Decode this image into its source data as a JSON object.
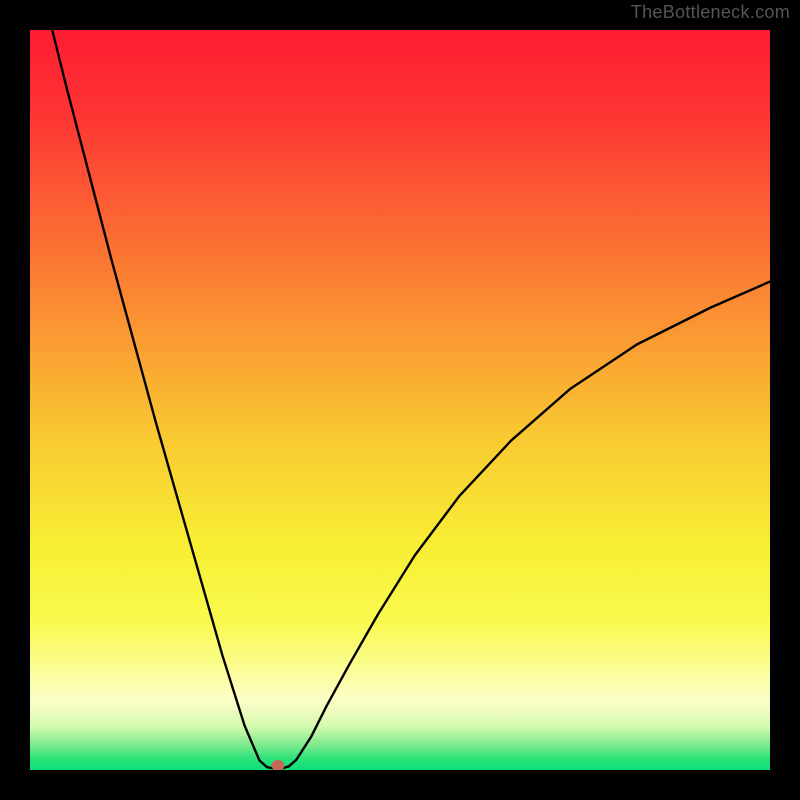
{
  "watermark": "TheBottleneck.com",
  "chart_data": {
    "type": "line",
    "title": "",
    "xlabel": "",
    "ylabel": "",
    "xlim": [
      0,
      100
    ],
    "ylim": [
      0,
      100
    ],
    "grid": false,
    "legend": false,
    "background_gradient": [
      {
        "offset": 0.0,
        "color": "#fe1c32"
      },
      {
        "offset": 0.12,
        "color": "#fd3633"
      },
      {
        "offset": 0.25,
        "color": "#fb6333"
      },
      {
        "offset": 0.4,
        "color": "#fa9533"
      },
      {
        "offset": 0.55,
        "color": "#f9c932"
      },
      {
        "offset": 0.7,
        "color": "#f8ef34"
      },
      {
        "offset": 0.8,
        "color": "#f9fa4f"
      },
      {
        "offset": 0.86,
        "color": "#fbfc90"
      },
      {
        "offset": 0.905,
        "color": "#fdfec8"
      },
      {
        "offset": 0.94,
        "color": "#d7fab1"
      },
      {
        "offset": 0.965,
        "color": "#82eb8e"
      },
      {
        "offset": 0.985,
        "color": "#2de27a"
      },
      {
        "offset": 1.0,
        "color": "#0bdf79"
      }
    ],
    "series": [
      {
        "name": "bottleneck_curve",
        "x": [
          3,
          5,
          8,
          11,
          14,
          17,
          20,
          23,
          26,
          29,
          31,
          32,
          33,
          34,
          35,
          36,
          38,
          40,
          43,
          47,
          52,
          58,
          65,
          73,
          82,
          92,
          100
        ],
        "y": [
          100,
          92,
          80.5,
          69,
          58,
          47,
          36.5,
          26,
          15.5,
          6,
          1.3,
          0.4,
          0.2,
          0.2,
          0.5,
          1.4,
          4.5,
          8.5,
          14,
          21,
          29,
          37,
          44.5,
          51.5,
          57.5,
          62.5,
          66
        ]
      }
    ],
    "marker": {
      "x": 33.5,
      "y": 0.6,
      "color": "#c26a55"
    }
  }
}
